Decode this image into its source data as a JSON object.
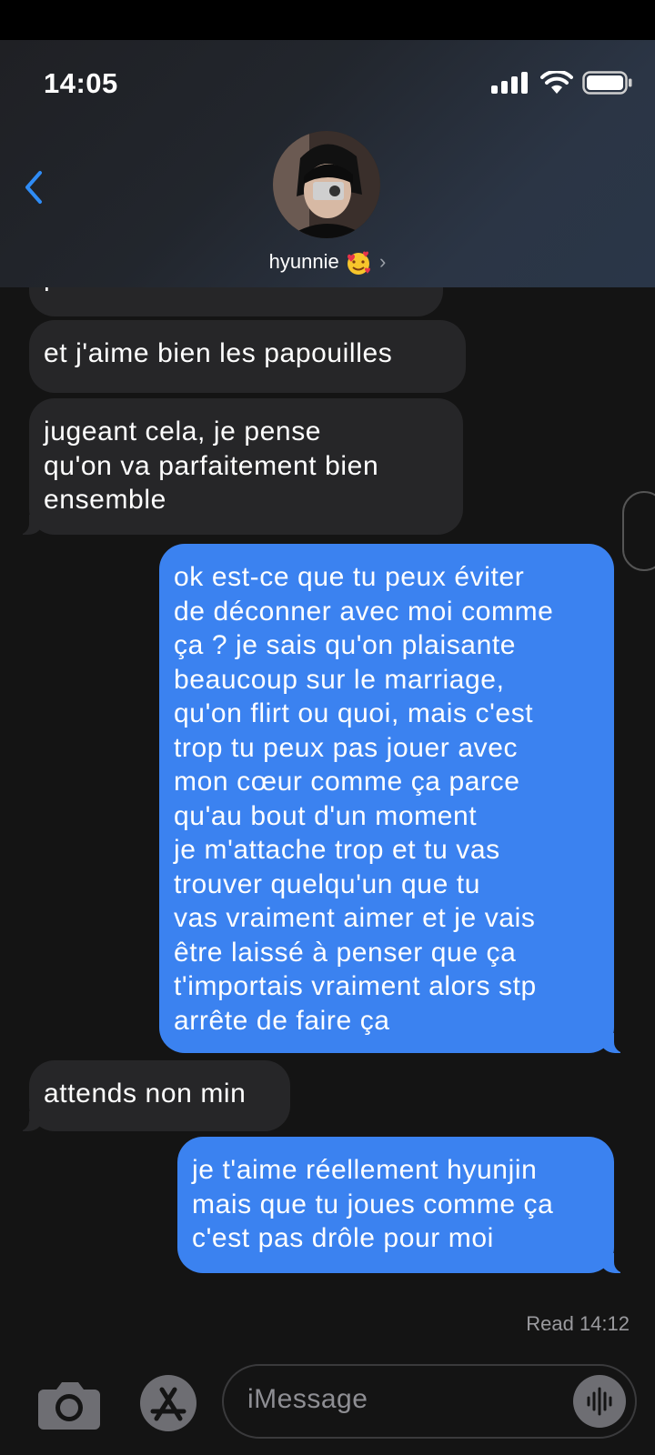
{
  "status_bar": {
    "time": "14:05"
  },
  "contact": {
    "name": "hyunnie"
  },
  "messages": [
    {
      "from": "contact",
      "text": "peu froide"
    },
    {
      "from": "contact",
      "text": "et j'aime bien les papouilles"
    },
    {
      "from": "contact",
      "text": "jugeant cela, je pense\nqu'on va parfaitement bien\nensemble"
    },
    {
      "from": "me",
      "text": "ok est-ce que tu peux éviter\nde déconner avec moi comme\nça ? je sais qu'on plaisante\nbeaucoup sur le marriage,\nqu'on flirt ou quoi, mais c'est\ntrop tu peux pas jouer avec\nmon cœur comme ça parce\nqu'au bout d'un moment\nje m'attache trop et tu vas\ntrouver quelqu'un que tu\nvas vraiment aimer et je vais\nêtre laissé à penser que ça\nt'importais vraiment alors stp\narrête de faire ça"
    },
    {
      "from": "contact",
      "text": "attends non min"
    },
    {
      "from": "me",
      "text": "je t'aime réellement hyunjin\nmais que tu joues comme ça\nc'est pas drôle pour moi"
    }
  ],
  "read_receipt": "Read 14:12",
  "composer": {
    "placeholder": "iMessage"
  },
  "icons": {
    "back": "chevron-left-icon",
    "camera": "camera-icon",
    "apps": "app-store-icon",
    "audio": "waveform-icon",
    "signal": "signal-icon",
    "wifi": "wifi-icon",
    "battery": "battery-icon",
    "emoji": "smiling-face-with-hearts-icon"
  },
  "colors": {
    "accent": "#2f8cf5",
    "sent_bubble": "#3b82f0",
    "received_bubble": "#262628",
    "background": "#141414"
  }
}
